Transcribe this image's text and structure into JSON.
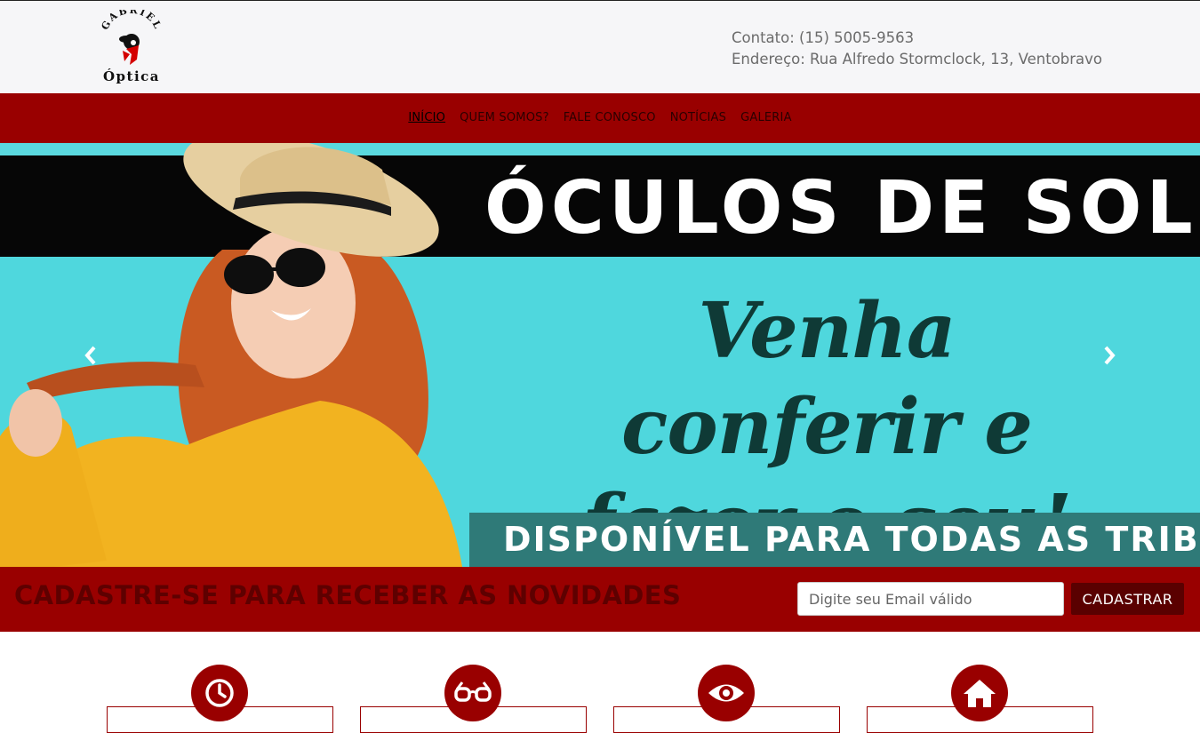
{
  "colors": {
    "brand": "#990000",
    "brand_dark": "#5a0000",
    "hero_bg": "#4fd7dd",
    "hero_script": "#0f3a36"
  },
  "logo": {
    "top_text": "GABRIEL",
    "bottom_text": "Óptica"
  },
  "header": {
    "contact": "Contato: (15) 5005-9563",
    "address": "Endereço: Rua Alfredo Stormclock, 13, Ventobravo"
  },
  "nav": {
    "items": [
      {
        "label": "INÍCIO",
        "active": true
      },
      {
        "label": "QUEM SOMOS?"
      },
      {
        "label": "FALE CONOSCO"
      },
      {
        "label": "NOTÍCIAS"
      },
      {
        "label": "GALERIA"
      }
    ]
  },
  "hero": {
    "title": "ÓCULOS DE SOL",
    "script_line1": "Venha conferir e",
    "script_line2": "fazer o seu!",
    "band": "DISPONÍVEL PARA TODAS AS TRIBOS",
    "prev_icon": "chevron-left-icon",
    "next_icon": "chevron-right-icon"
  },
  "signup": {
    "text": "CADASTRE-SE PARA RECEBER AS NOVIDADES",
    "email_placeholder": "Digite seu Email válido",
    "button": "CADASTRAR"
  },
  "features": [
    {
      "icon": "clock-icon"
    },
    {
      "icon": "glasses-icon"
    },
    {
      "icon": "eye-icon"
    },
    {
      "icon": "home-icon"
    }
  ]
}
